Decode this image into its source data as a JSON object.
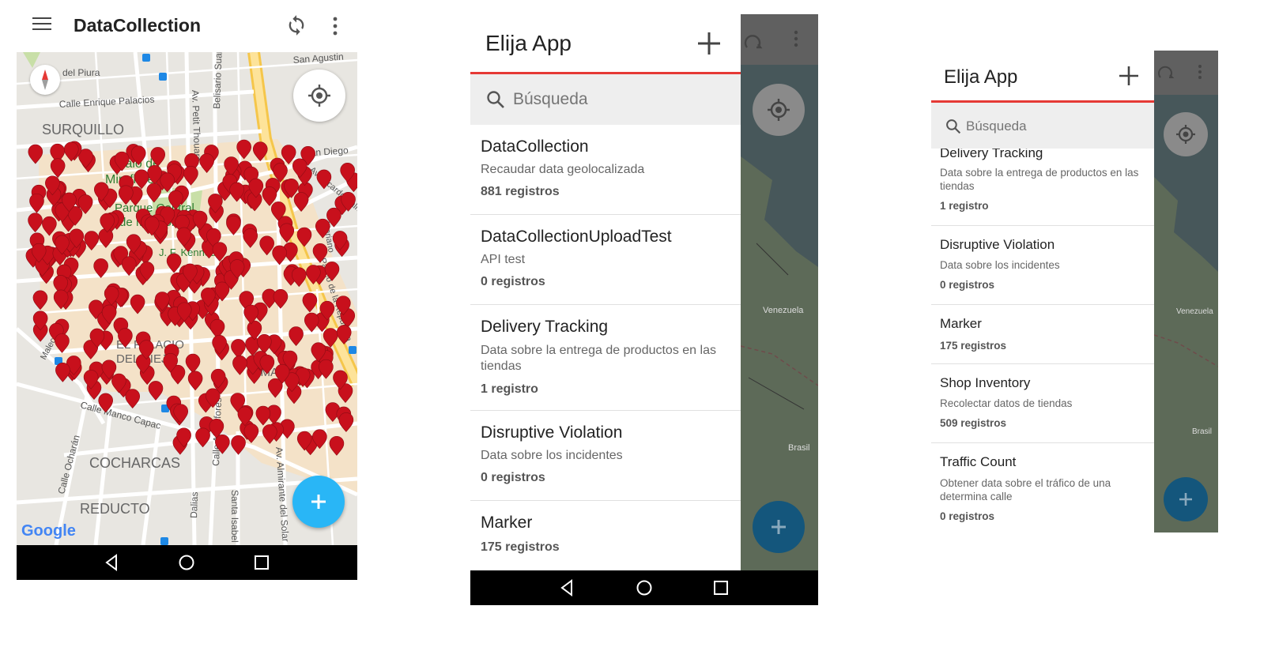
{
  "screen1": {
    "app_title": "DataCollection",
    "map_labels": {
      "pueblo_libre": "del Piura",
      "san_agustin": "San Agustin",
      "enrique_palacios": "Calle Enrique Palacios",
      "surquillo": "SURQUILLO",
      "petit_thouars": "Av. Petit Thouars",
      "belisario": "Belisario Suarez",
      "san_diego": "San Diego",
      "ovalo": "Óvalo de",
      "miraflores": "Miraflores",
      "parque": "Parque Central",
      "de_miraflores": "de Miraflores",
      "kennedy": "J. F. Kennedy",
      "ricardo_palma": "Av. Ricardo Palma",
      "mariano": "Mariano",
      "paseo_republica": "Av. Paseo de la República",
      "malecon": "Malecón",
      "el_palacio": "EL PALACIO",
      "del_viejo": "DEL VIEJO",
      "lima": "LIMA",
      "manco_capac": "Calle Manco Capac",
      "ocharan": "Calle Ocharán",
      "cocharcas": "COCHARCAS",
      "reducto": "REDUCTO",
      "alcanfores": "Calle Alcanfores",
      "dalias": "Dalias",
      "santa_isabel": "Santa Isabel",
      "solar": "Av. Almirante del Solar",
      "google": "Google"
    },
    "colors": {
      "marker": "#c8101c",
      "fab": "#29b6f6",
      "park": "#c8dfa7",
      "road_major": "#f7d57a",
      "block": "#f4e2c8"
    },
    "icons": {
      "menu": "menu-icon",
      "sync": "sync-icon",
      "more": "more-vert-icon",
      "compass": "compass-icon",
      "locate": "my-location-icon",
      "fab": "add-icon"
    }
  },
  "screen2": {
    "drawer_title": "Elija App",
    "search_placeholder": "Búsqueda",
    "items": [
      {
        "title": "DataCollection",
        "desc": "Recaudar data geolocalizada",
        "count": "881 registros"
      },
      {
        "title": "DataCollectionUploadTest",
        "desc": "API test",
        "count": "0 registros"
      },
      {
        "title": "Delivery Tracking",
        "desc": "Data sobre la entrega de productos en las tiendas",
        "count": "1 registro"
      },
      {
        "title": "Disruptive Violation",
        "desc": "Data sobre los incidentes",
        "count": "0 registros"
      },
      {
        "title": "Marker",
        "desc": "",
        "count": "175 registros"
      }
    ],
    "map_labels": {
      "venezuela": "Venezuela",
      "brasil": "Brasil"
    }
  },
  "screen3": {
    "drawer_title": "Elija App",
    "search_placeholder": "Búsqueda",
    "items": [
      {
        "title": "Delivery Tracking",
        "desc": "Data sobre la entrega de productos en las tiendas",
        "count": "1 registro"
      },
      {
        "title": "Disruptive Violation",
        "desc": "Data sobre los incidentes",
        "count": "0 registros"
      },
      {
        "title": "Marker",
        "desc": "",
        "count": "175 registros"
      },
      {
        "title": "Shop Inventory",
        "desc": "Recolectar datos de tiendas",
        "count": "509 registros"
      },
      {
        "title": "Traffic Count",
        "desc": "Obtener data sobre el tráfico de una determina calle",
        "count": "0 registros"
      }
    ],
    "map_labels": {
      "venezuela": "Venezuela",
      "brasil": "Brasil"
    }
  }
}
